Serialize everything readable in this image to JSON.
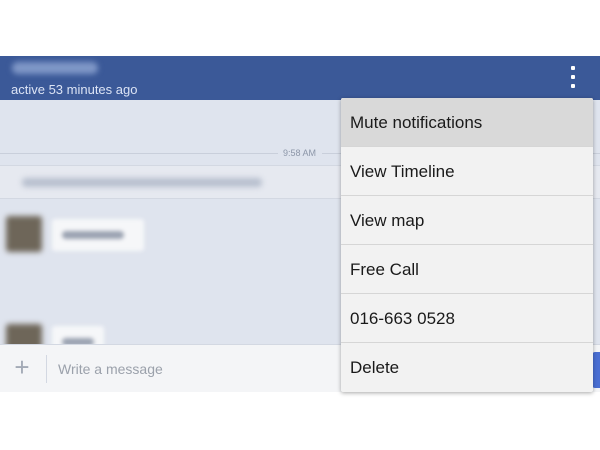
{
  "header": {
    "contact_name": "",
    "status": "active 53 minutes ago",
    "overflow_icon": "overflow-menu-icon"
  },
  "chat": {
    "timestamp": "9:58 AM",
    "system_message": "",
    "messages": [
      {
        "text": ""
      },
      {
        "text": ""
      }
    ]
  },
  "composer": {
    "add_icon": "plus-icon",
    "placeholder": "Write a message"
  },
  "menu": {
    "items": [
      {
        "label": "Mute notifications"
      },
      {
        "label": "View Timeline"
      },
      {
        "label": "View map"
      },
      {
        "label": "Free Call"
      },
      {
        "label": "016-663 0528"
      },
      {
        "label": "Delete"
      }
    ]
  }
}
